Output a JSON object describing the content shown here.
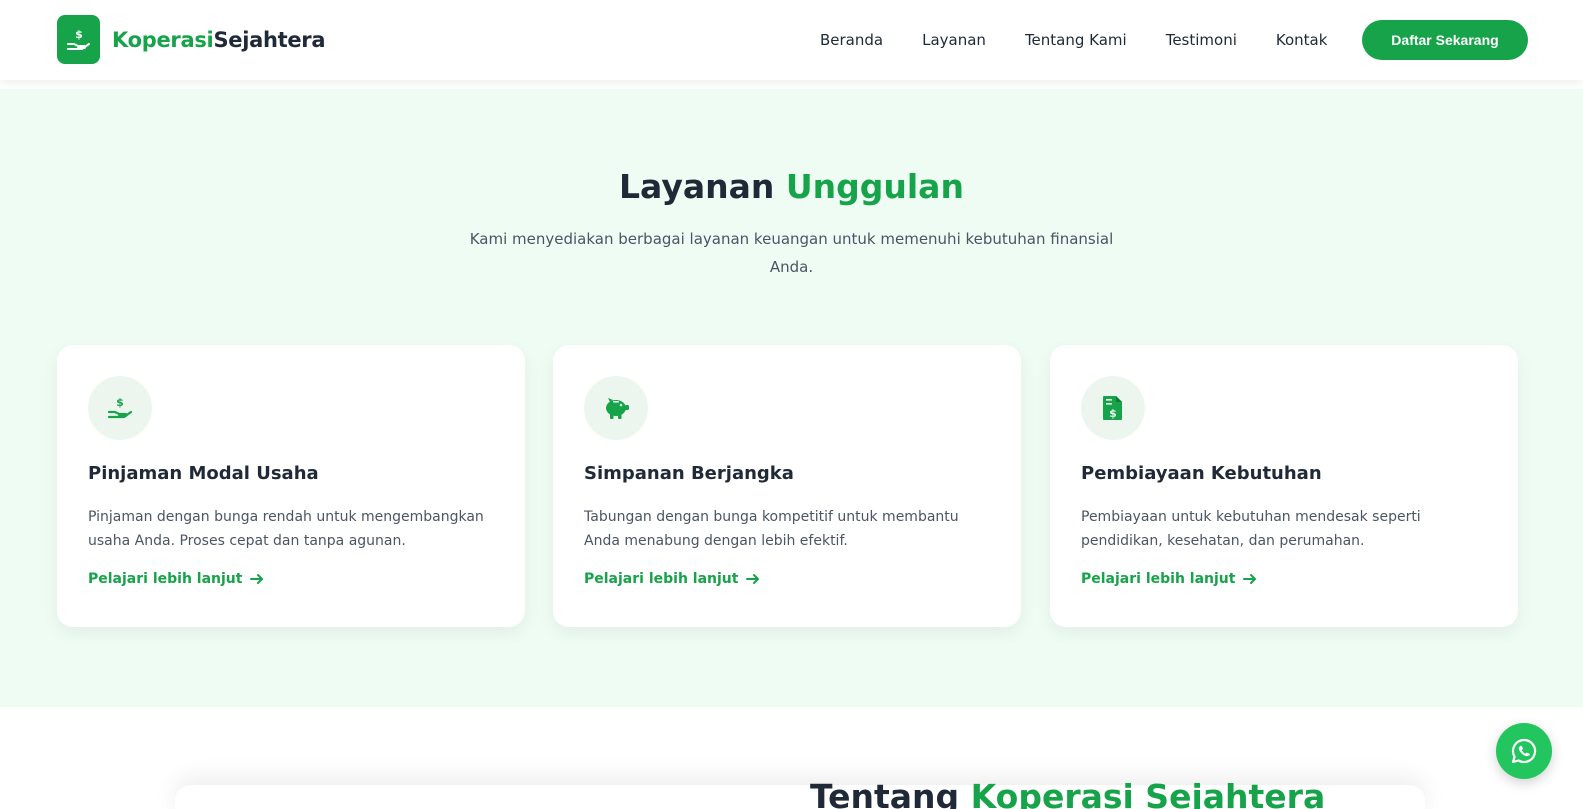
{
  "brand": {
    "part1": "Koperasi",
    "part2": "Sejahtera",
    "logo_icon": "hand-dollar-icon"
  },
  "nav": {
    "items": [
      {
        "label": "Beranda"
      },
      {
        "label": "Layanan"
      },
      {
        "label": "Tentang Kami"
      },
      {
        "label": "Testimoni"
      },
      {
        "label": "Kontak"
      }
    ],
    "cta_label": "Daftar Sekarang"
  },
  "services": {
    "title_plain": "Layanan ",
    "title_accent": "Unggulan",
    "subtitle": "Kami menyediakan berbagai layanan keuangan untuk memenuhi kebutuhan finansial Anda.",
    "cards": [
      {
        "icon": "hand-dollar-icon",
        "title": "Pinjaman Modal Usaha",
        "desc": "Pinjaman dengan bunga rendah untuk mengembangkan usaha Anda. Proses cepat dan tanpa agunan.",
        "link": "Pelajari lebih lanjut"
      },
      {
        "icon": "piggy-bank-icon",
        "title": "Simpanan Berjangka",
        "desc": "Tabungan dengan bunga kompetitif untuk membantu Anda menabung dengan lebih efektif.",
        "link": "Pelajari lebih lanjut"
      },
      {
        "icon": "invoice-dollar-icon",
        "title": "Pembiayaan Kebutuhan",
        "desc": "Pembiayaan untuk kebutuhan mendesak seperti pendidikan, kesehatan, dan perumahan.",
        "link": "Pelajari lebih lanjut"
      }
    ]
  },
  "about": {
    "title_plain": "Tentang ",
    "title_accent": "Koperasi Sejahtera"
  },
  "whatsapp": {
    "icon": "whatsapp-icon"
  },
  "colors": {
    "accent": "#16a34a",
    "section_bg": "#effcf3",
    "text": "#1f2937",
    "whatsapp": "#22c55e"
  }
}
